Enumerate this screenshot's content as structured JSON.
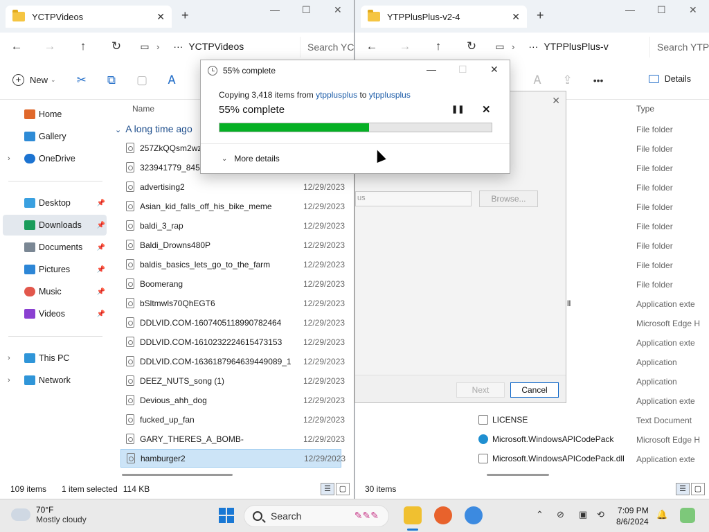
{
  "left": {
    "tab_title": "YCTPVideos",
    "breadcrumb": "YCTPVideos",
    "search_placeholder": "Search YCTPVideos",
    "new_label": "New",
    "sidebar": [
      {
        "label": "Home",
        "icon": "home-icon",
        "color": "#e0682b"
      },
      {
        "label": "Gallery",
        "icon": "gallery-icon",
        "color": "#2e8bd6"
      },
      {
        "label": "OneDrive",
        "icon": "cloud-icon",
        "color": "#1c73d1"
      },
      {
        "label": "Desktop",
        "icon": "desktop-icon",
        "color": "#3aa0e0"
      },
      {
        "label": "Downloads",
        "icon": "download-icon",
        "color": "#1a9c5a"
      },
      {
        "label": "Documents",
        "icon": "document-icon",
        "color": "#7a8794"
      },
      {
        "label": "Pictures",
        "icon": "pictures-icon",
        "color": "#2d86d6"
      },
      {
        "label": "Music",
        "icon": "music-icon",
        "color": "#e2574c"
      },
      {
        "label": "Videos",
        "icon": "videos-icon",
        "color": "#8a3fd1"
      },
      {
        "label": "This PC",
        "icon": "pc-icon",
        "color": "#2f95d8"
      },
      {
        "label": "Network",
        "icon": "network-icon",
        "color": "#2f95d8"
      }
    ],
    "col_name": "Name",
    "group_label": "A long time ago",
    "files": [
      {
        "name": "257ZkQQsm2wzl",
        "date": ""
      },
      {
        "name": "323941779_84544",
        "date": ""
      },
      {
        "name": "advertising2",
        "date": "12/29/2023"
      },
      {
        "name": "Asian_kid_falls_off_his_bike_meme",
        "date": "12/29/2023"
      },
      {
        "name": "baldi_3_rap",
        "date": "12/29/2023"
      },
      {
        "name": "Baldi_Drowns480P",
        "date": "12/29/2023"
      },
      {
        "name": "baldis_basics_lets_go_to_the_farm",
        "date": "12/29/2023"
      },
      {
        "name": "Boomerang",
        "date": "12/29/2023"
      },
      {
        "name": "bSltmwls70QhEGT6",
        "date": "12/29/2023"
      },
      {
        "name": "DDLVID.COM-1607405118990782464",
        "date": "12/29/2023"
      },
      {
        "name": "DDLVID.COM-1610232224615473153",
        "date": "12/29/2023"
      },
      {
        "name": "DDLVID.COM-1636187964639449089_1",
        "date": "12/29/2023"
      },
      {
        "name": "DEEZ_NUTS_song (1)",
        "date": "12/29/2023"
      },
      {
        "name": "Devious_ahh_dog",
        "date": "12/29/2023"
      },
      {
        "name": "fucked_up_fan",
        "date": "12/29/2023"
      },
      {
        "name": "GARY_THERES_A_BOMB-",
        "date": "12/29/2023"
      },
      {
        "name": "hamburger2",
        "date": "12/29/2023"
      }
    ],
    "status_items": "109 items",
    "status_selected": "1 item selected",
    "status_size": "114 KB"
  },
  "right": {
    "tab_title": "YTPPlusPlus-v2-4",
    "breadcrumb": "YTPPlusPlus-v",
    "search_placeholder": "Search YTPPlusPlus-v2-4",
    "details_label": "Details",
    "col_type": "Type",
    "types": [
      "File folder",
      "File folder",
      "File folder",
      "File folder",
      "File folder",
      "File folder",
      "File folder",
      "File folder",
      "File folder",
      "Application exte",
      "Microsoft Edge H",
      "Application exte",
      "Application",
      "Application",
      "Application exte",
      "Text Document",
      "Microsoft Edge H",
      "Application exte"
    ],
    "partial_text": "ll",
    "visible_files": [
      {
        "name": "LICENSE",
        "icon": "text-file-icon",
        "color": "#777777"
      },
      {
        "name": "Microsoft.WindowsAPICodePack",
        "icon": "edge-icon",
        "color": "#1f8fd1"
      },
      {
        "name": "Microsoft.WindowsAPICodePack.dll",
        "icon": "dll-file-icon",
        "color": "#777777"
      }
    ],
    "status_items": "30 items"
  },
  "wizard": {
    "path_fragment": "us",
    "browse_label": "Browse...",
    "next_label": "Next",
    "cancel_label": "Cancel"
  },
  "progress_dialog": {
    "title": "55% complete",
    "copy_prefix": "Copying 3,418 items from ",
    "source": "ytpplusplus",
    "to_word": " to ",
    "destination": "ytpplusplus",
    "percent_text": "55% complete",
    "progress": 0.55,
    "more_details": "More details",
    "bar_color": "#06b025"
  },
  "taskbar": {
    "temperature": "70°F",
    "condition": "Mostly cloudy",
    "search_label": "Search",
    "time": "7:09 PM",
    "date": "8/6/2024"
  }
}
